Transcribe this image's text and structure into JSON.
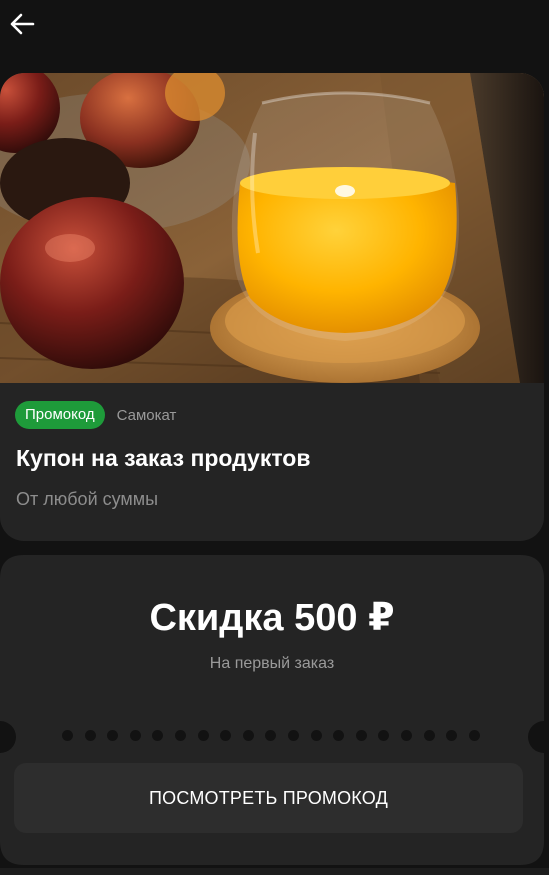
{
  "header": {
    "back_icon": "arrow-left-icon"
  },
  "coupon": {
    "image_alt_icon": "juice-and-peaches-photo",
    "badge_label": "Промокод",
    "badge_color": "#1e9b3a",
    "brand": "Самокат",
    "title": "Купон на заказ продуктов",
    "subtitle": "От любой суммы"
  },
  "offer": {
    "discount": "Скидка 500 ₽",
    "condition": "На первый заказ",
    "button_label": "ПОСМОТРЕТЬ ПРОМОКОД"
  },
  "colors": {
    "background": "#121212",
    "card": "#242424",
    "button": "#2d2d2d",
    "muted_text": "#9a9a9a"
  }
}
